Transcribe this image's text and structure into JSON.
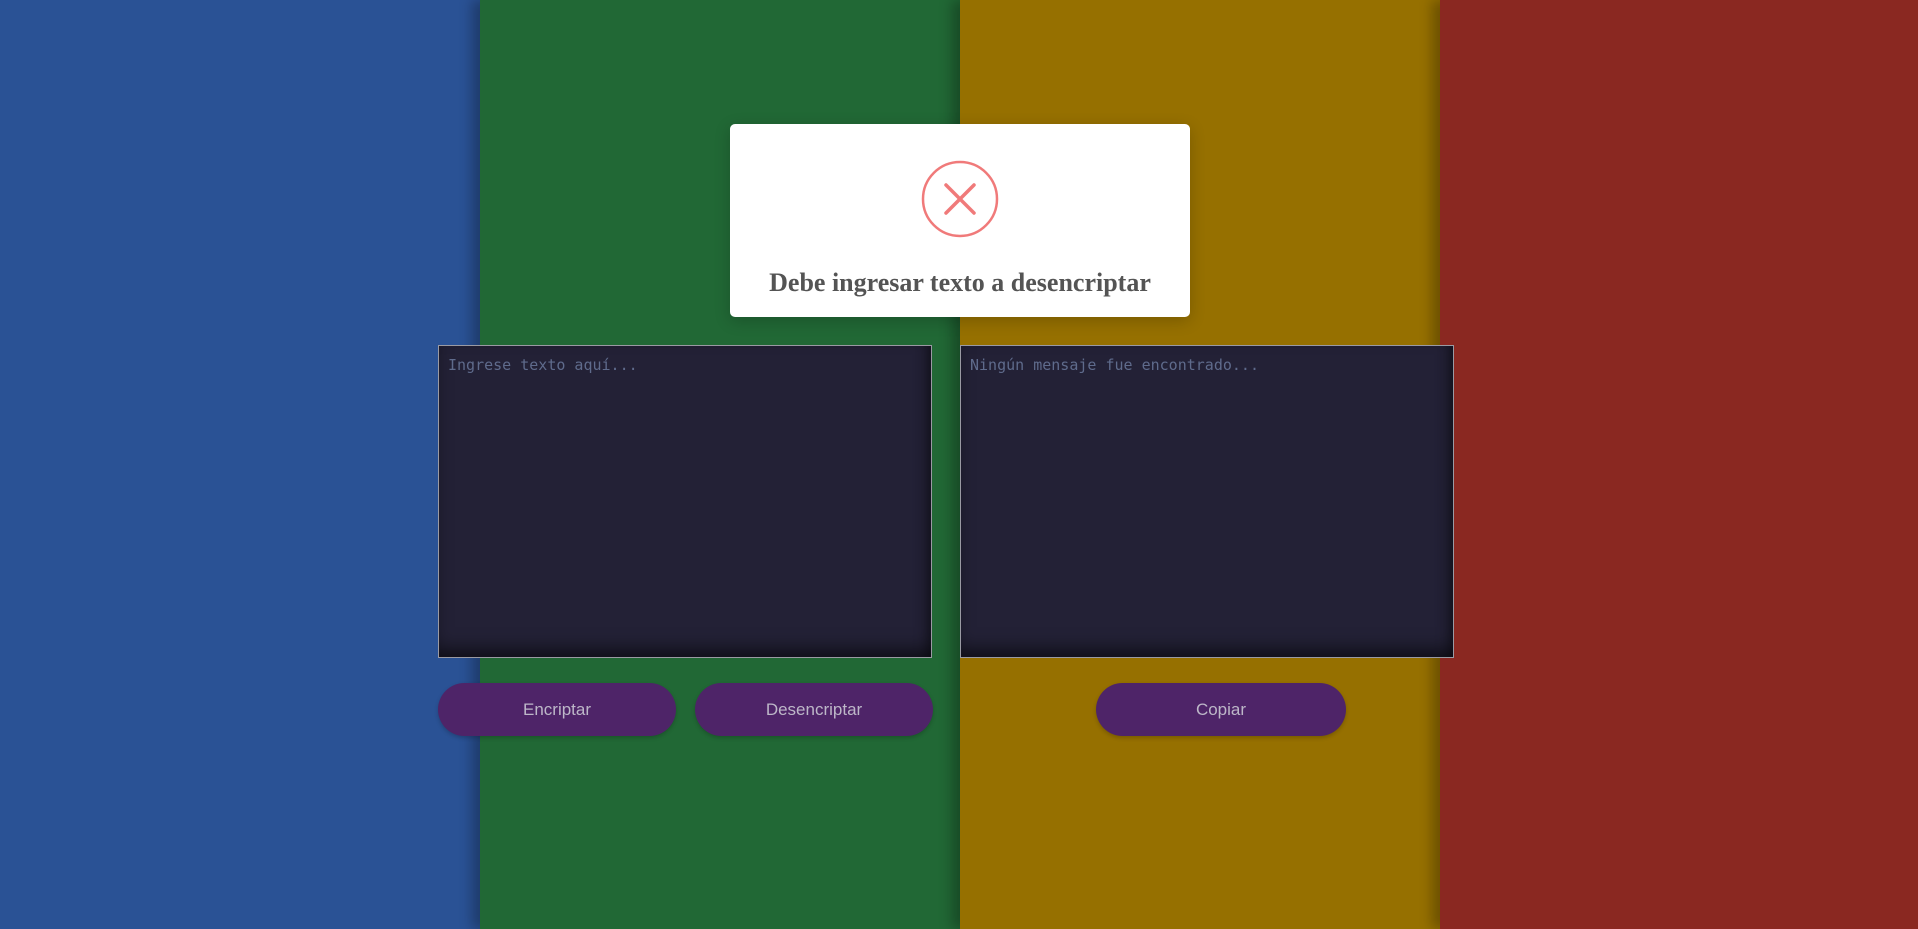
{
  "colors": {
    "stripe_blue": "#2a5295",
    "stripe_green": "#216835",
    "stripe_gold": "#967000",
    "stripe_red": "#8a2821",
    "panel_bg": "#232136",
    "button_bg": "#4e2468",
    "button_text": "#bdb7c8",
    "error_red": "#f07a7a"
  },
  "input_panel": {
    "placeholder": "Ingrese texto aquí...",
    "value": ""
  },
  "output_panel": {
    "placeholder": "Ningún mensaje fue encontrado...",
    "value": ""
  },
  "buttons": {
    "encrypt_label": "Encriptar",
    "decrypt_label": "Desencriptar",
    "copy_label": "Copiar"
  },
  "alert": {
    "icon": "error-x-icon",
    "message": "Debe ingresar texto a desencriptar"
  }
}
